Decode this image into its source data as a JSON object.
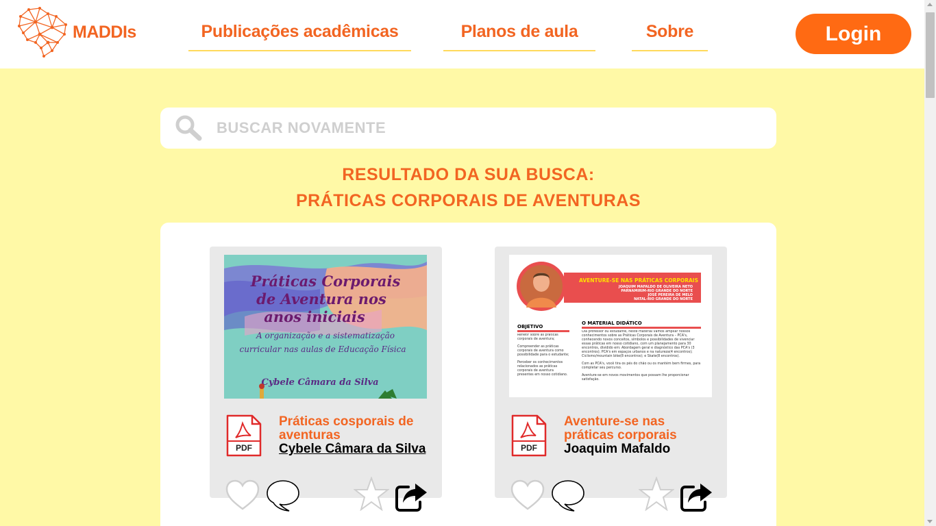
{
  "brand": {
    "name": "MADDIs",
    "accent": "#f26522",
    "button": "#ff6a13",
    "background": "#fff9a6"
  },
  "nav": {
    "publications": "Publicações acadêmicas",
    "lesson_plans": "Planos de aula",
    "about": "Sobre",
    "login": "Login"
  },
  "search": {
    "placeholder": "BUSCAR NOVAMENTE",
    "value": ""
  },
  "results": {
    "heading_line1": "RESULTADO DA SUA BUSCA:",
    "heading_line2": "PRÁTICAS CORPORAIS DE AVENTURAS"
  },
  "cards": [
    {
      "title": "Práticas cosporais de aventuras",
      "author": "Cybele Câmara da Silva",
      "file_type": "PDF",
      "cover": {
        "line1": "Práticas Corporais",
        "line2": "de Aventura nos",
        "line3": "anos iniciais",
        "subtitle1": "A organização e a sistematização",
        "subtitle2": "curricular nas aulas de Educação Física",
        "author": "Cybele Câmara da Silva"
      }
    },
    {
      "title": "Aventure-se nas práticas corporais",
      "author": "Joaquim Mafaldo",
      "file_type": "PDF",
      "cover": {
        "banner_title": "AVENTURE-SE NAS PRÁTICAS CORPORAIS",
        "banner_line1": "JOAQUIM MAFALDO DE OLIVEIRA NETO",
        "banner_line2": "PARNAMIRIM-RIO GRANDE DO NORTE",
        "banner_line3": "JOSÉ PEREIRA DE MELO",
        "banner_line4": "NATAL-RIO GRANDE DO NORTE",
        "objective_heading": "OBJETIVO",
        "objective_1": "Refletir sobre as práticas corporais de aventura;",
        "objective_2": "Compreender as práticas corporais de aventura como possibilidade para o estudante;",
        "objective_3": "Perceber os conhecimentos relacionados as práticas corporais de aventura presentes em nosso cotidiano.",
        "material_heading": "O MATERIAL DIDÁTICO",
        "material_p1": "Olá professor ou estudante, neste material vamos ampliar nossos conhecimentos sobre as Práticas Corporais de Aventura – PCA's, conhecendo novos conceitos, símbolos e possibilidades de vivenciar essas práticas em nosso cotidiano, com um planejamento para 30 encontros, dividido em: Abordagem geral e diagnóstico das PCA's (3 encontros); PCA's em espaços urbanos e na natureza(4 encontros); Ciclismo/mountain bike(8 encontros); e Skate(8 encontros).",
        "material_p2": "Com as PCA's, você tira os pés do chão ou os mantém bem firmes, para completar seu percurso.",
        "material_p3": "Aventure-se em novos movimentos que possam lhe proporcionar satisfação."
      }
    }
  ],
  "icons": {
    "logo": "brazil-network-icon",
    "search": "search-icon",
    "file": "pdf-icon",
    "like": "heart-icon",
    "comment": "comment-icon",
    "favorite": "star-icon",
    "share": "share-icon"
  }
}
